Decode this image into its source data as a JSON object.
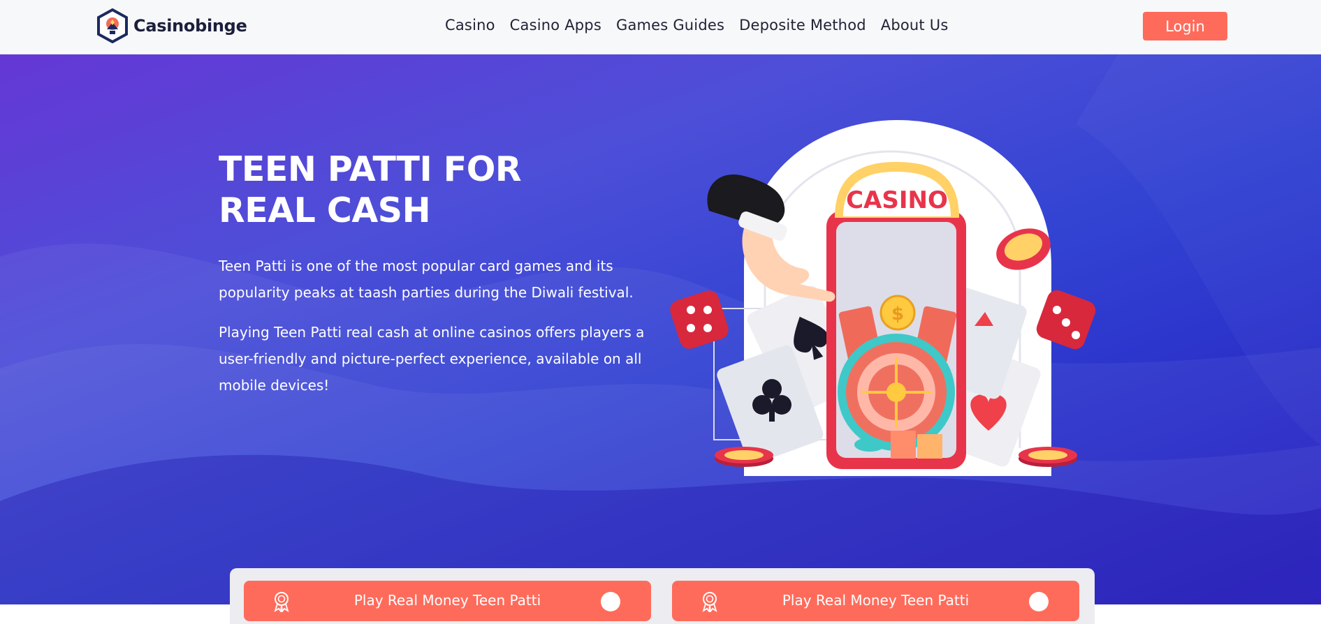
{
  "header": {
    "logo_text": "Casinobinge",
    "nav": [
      "Casino",
      "Casino Apps",
      "Games Guides",
      "Deposite Method",
      "About Us"
    ],
    "login_label": "Login"
  },
  "hero": {
    "title": "TEEN PATTI FOR REAL CASH",
    "paragraph_1": "Teen Patti is one of the most popular card games and its popularity peaks at taash parties during the Diwali festival.",
    "paragraph_2": "Playing Teen Patti real cash at online casinos offers players a user-friendly and picture-perfect experience, available on all mobile devices!",
    "illustration_sign": "CASINO"
  },
  "cta": {
    "buttons": [
      {
        "label": "Play Real Money Teen Patti",
        "icon": "award-icon"
      },
      {
        "label": "Play Real Money Teen Patti",
        "icon": "award-icon"
      }
    ]
  },
  "colors": {
    "accent": "#ff6b5b",
    "hero_top": "#6537d5",
    "hero_bottom": "#2119c0",
    "header_bg": "#f7f8fa"
  }
}
